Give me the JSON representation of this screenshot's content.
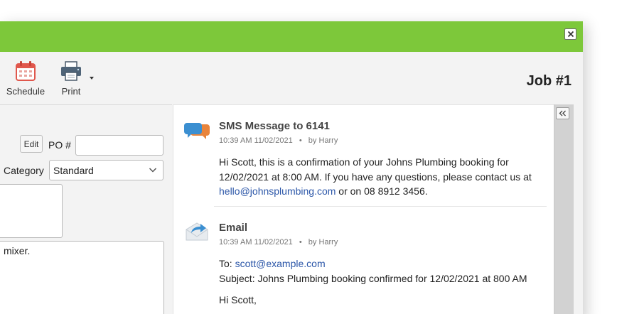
{
  "window": {
    "title_color": "#7dc83a",
    "close_icon": "close-icon"
  },
  "toolbar": {
    "schedule_label": "Schedule",
    "print_label": "Print",
    "job_title": "Job #1"
  },
  "form": {
    "edit_label": "Edit",
    "po_label": "PO #",
    "po_value": "",
    "category_label": "Category",
    "category_value": "Standard",
    "notes_text": "mixer."
  },
  "feed": {
    "items": [
      {
        "type": "sms",
        "icon": "chat-bubbles-icon",
        "title": "SMS Message to 6141",
        "time": "10:39 AM 11/02/2021",
        "bullet": "•",
        "by": "by Harry",
        "body_before": "Hi Scott, this is a confirmation of your Johns Plumbing booking for 12/02/2021 at 8:00 AM. If you have any questions, please contact us at ",
        "body_link": "hello@johnsplumbing.com",
        "body_after": " or on 08 8912 3456."
      },
      {
        "type": "email",
        "icon": "email-forward-icon",
        "title": "Email",
        "time": "10:39 AM 11/02/2021",
        "bullet": "•",
        "by": "by Harry",
        "to_label": "To: ",
        "to_link": "scott@example.com",
        "subject": "Subject: Johns Plumbing booking confirmed for 12/02/2021 at 800 AM",
        "greeting": "Hi Scott,"
      }
    ]
  },
  "colors": {
    "link": "#2b56a8",
    "accent": "#7dc83a",
    "calendar_red": "#e0574c"
  }
}
